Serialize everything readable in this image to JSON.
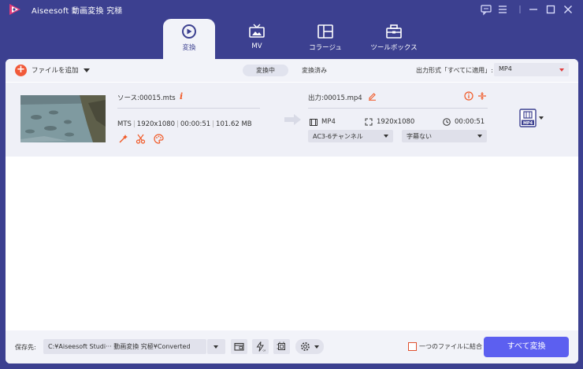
{
  "app": {
    "title": "Aiseesoft 動画変換 究極"
  },
  "tabs": [
    {
      "label": "変換",
      "icon": "convert-icon",
      "active": true
    },
    {
      "label": "MV",
      "icon": "tv-icon"
    },
    {
      "label": "コラージュ",
      "icon": "collage-icon"
    },
    {
      "label": "ツールボックス",
      "icon": "toolbox-icon"
    }
  ],
  "toolbar": {
    "add_file_label": "ファイルを追加",
    "segment_converting": "変換中",
    "segment_converted": "変換済み",
    "output_format_label": "出力形式「すべてに適用」:",
    "output_format_value": "MP4"
  },
  "file": {
    "source_name": "ソース:00015.mts",
    "format": "MTS",
    "resolution": "1920x1080",
    "duration": "00:00:51",
    "size": "101.62 MB",
    "output_name": "出力:00015.mp4",
    "output_format": "MP4",
    "output_resolution": "1920x1080",
    "output_duration": "00:00:51",
    "audio_track": "AC3-6チャンネル",
    "subtitle": "字幕ない",
    "format_badge": "MP4"
  },
  "bottom": {
    "save_to_label": "保存先:",
    "save_path": "C:¥Aiseesoft Studi··· 動画変換 究極¥Converted",
    "merge_label": "一つのファイルに結合",
    "merge_checked": false,
    "convert_all_label": "すべて変換"
  },
  "colors": {
    "window_bg": "#3c4090",
    "accent_orange": "#f15a3a",
    "convert_button": "#5c5ff0",
    "panel_bg": "#f2f3f9"
  }
}
